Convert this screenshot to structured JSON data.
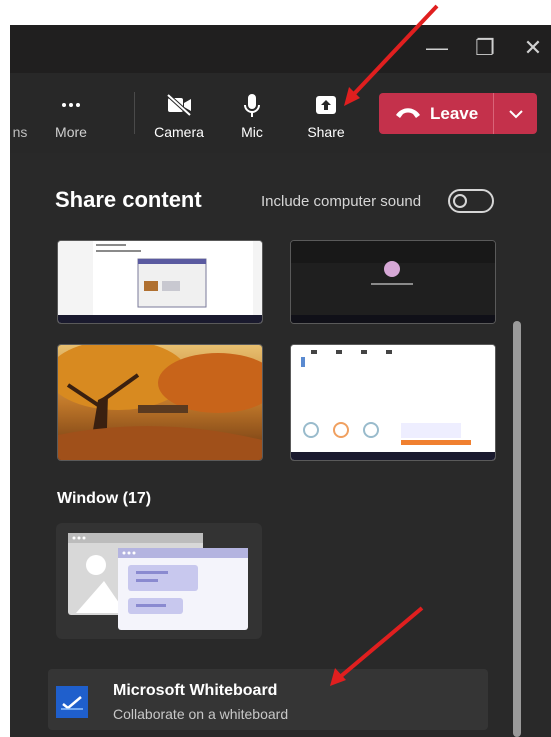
{
  "window": {
    "controls": {
      "minimize": "—",
      "restore": "❐",
      "close": "✕"
    }
  },
  "toolbar": {
    "cut_off_label": "ns",
    "more_label": "More",
    "camera_label": "Camera",
    "mic_label": "Mic",
    "share_label": "Share",
    "leave_label": "Leave"
  },
  "share_panel": {
    "title": "Share content",
    "include_sound_label": "Include computer sound",
    "include_sound_on": false,
    "window_section_label": "Window (17)",
    "whiteboard": {
      "title": "Microsoft Whiteboard",
      "subtitle": "Collaborate on a whiteboard"
    }
  },
  "colors": {
    "leave": "#c4314b",
    "panel": "#292929",
    "toolbar": "#282828",
    "annotation_arrow": "#e01f1f"
  },
  "icons": [
    "more-icon",
    "camera-off-icon",
    "mic-icon",
    "share-tray-icon",
    "phone-hangup-icon",
    "chevron-down-icon",
    "whiteboard-icon"
  ]
}
